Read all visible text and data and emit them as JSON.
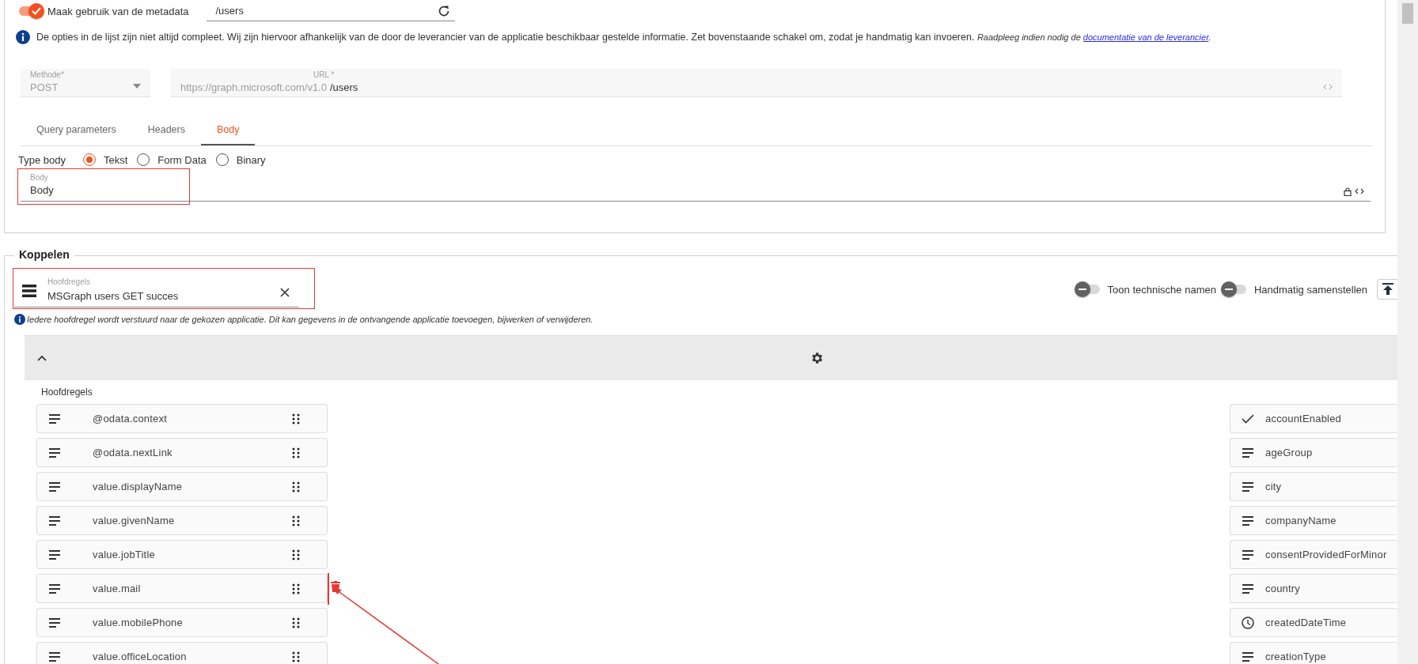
{
  "metadata_toggle": {
    "label": "Maak gebruik van de metadata",
    "on": true
  },
  "location_field": {
    "value": "/users"
  },
  "info": {
    "text": "De opties in de lijst zijn niet altijd compleet. Wij zijn hiervoor afhankelijk van de door de leverancier van de applicatie beschikbaar gestelde informatie. Zet bovenstaande schakel om, zodat je handmatig kan invoeren.",
    "note": "Raadpleeg indien nodig de",
    "link": "documentatie van de leverancier",
    "end": "."
  },
  "method_field": {
    "label": "Methode*",
    "value": "POST",
    "disabled": true
  },
  "url_field": {
    "label": "URL *",
    "prefix": "https://graph.microsoft.com/v1.0",
    "value": "/users",
    "disabled": true
  },
  "tabs": [
    {
      "label": "Query parameters",
      "selected": false
    },
    {
      "label": "Headers",
      "selected": false
    },
    {
      "label": "Body",
      "selected": true
    }
  ],
  "body_type": {
    "label": "Type body",
    "options": [
      {
        "label": "Tekst",
        "selected": true
      },
      {
        "label": "Form Data",
        "selected": false
      },
      {
        "label": "Binary",
        "selected": false
      }
    ]
  },
  "body_field": {
    "label": "Body",
    "value": "Body",
    "highlighted": true
  },
  "koppelen": {
    "title": "Koppelen",
    "hoofdregels_field": {
      "label": "Hoofdregels",
      "value": "MSGraph users GET succes",
      "highlighted": true
    },
    "toggles": [
      {
        "label": "Toon technische namen",
        "on": false
      },
      {
        "label": "Handmatig samenstellen",
        "on": false
      }
    ],
    "info": "Iedere hoofdregel wordt verstuurd naar de gekozen applicatie. Dit kan gegevens in de ontvangende applicatie toevoegen, bijwerken of verwijderen.",
    "list_label": "Hoofdregels",
    "left_items": [
      {
        "name": "@odata.context",
        "kind": "text",
        "drop_target": false
      },
      {
        "name": "@odata.nextLink",
        "kind": "text",
        "drop_target": false
      },
      {
        "name": "value.displayName",
        "kind": "text",
        "drop_target": false
      },
      {
        "name": "value.givenName",
        "kind": "text",
        "drop_target": false
      },
      {
        "name": "value.jobTitle",
        "kind": "text",
        "drop_target": false
      },
      {
        "name": "value.mail",
        "kind": "text",
        "drop_target": true
      },
      {
        "name": "value.mobilePhone",
        "kind": "text",
        "drop_target": false
      },
      {
        "name": "value.officeLocation",
        "kind": "text",
        "drop_target": false
      }
    ],
    "right_items": [
      {
        "name": "accountEnabled",
        "kind": "boolean"
      },
      {
        "name": "ageGroup",
        "kind": "text"
      },
      {
        "name": "city",
        "kind": "text"
      },
      {
        "name": "companyName",
        "kind": "text"
      },
      {
        "name": "consentProvidedForMinor",
        "kind": "text"
      },
      {
        "name": "country",
        "kind": "text"
      },
      {
        "name": "createdDateTime",
        "kind": "datetime"
      },
      {
        "name": "creationType",
        "kind": "text"
      }
    ]
  }
}
